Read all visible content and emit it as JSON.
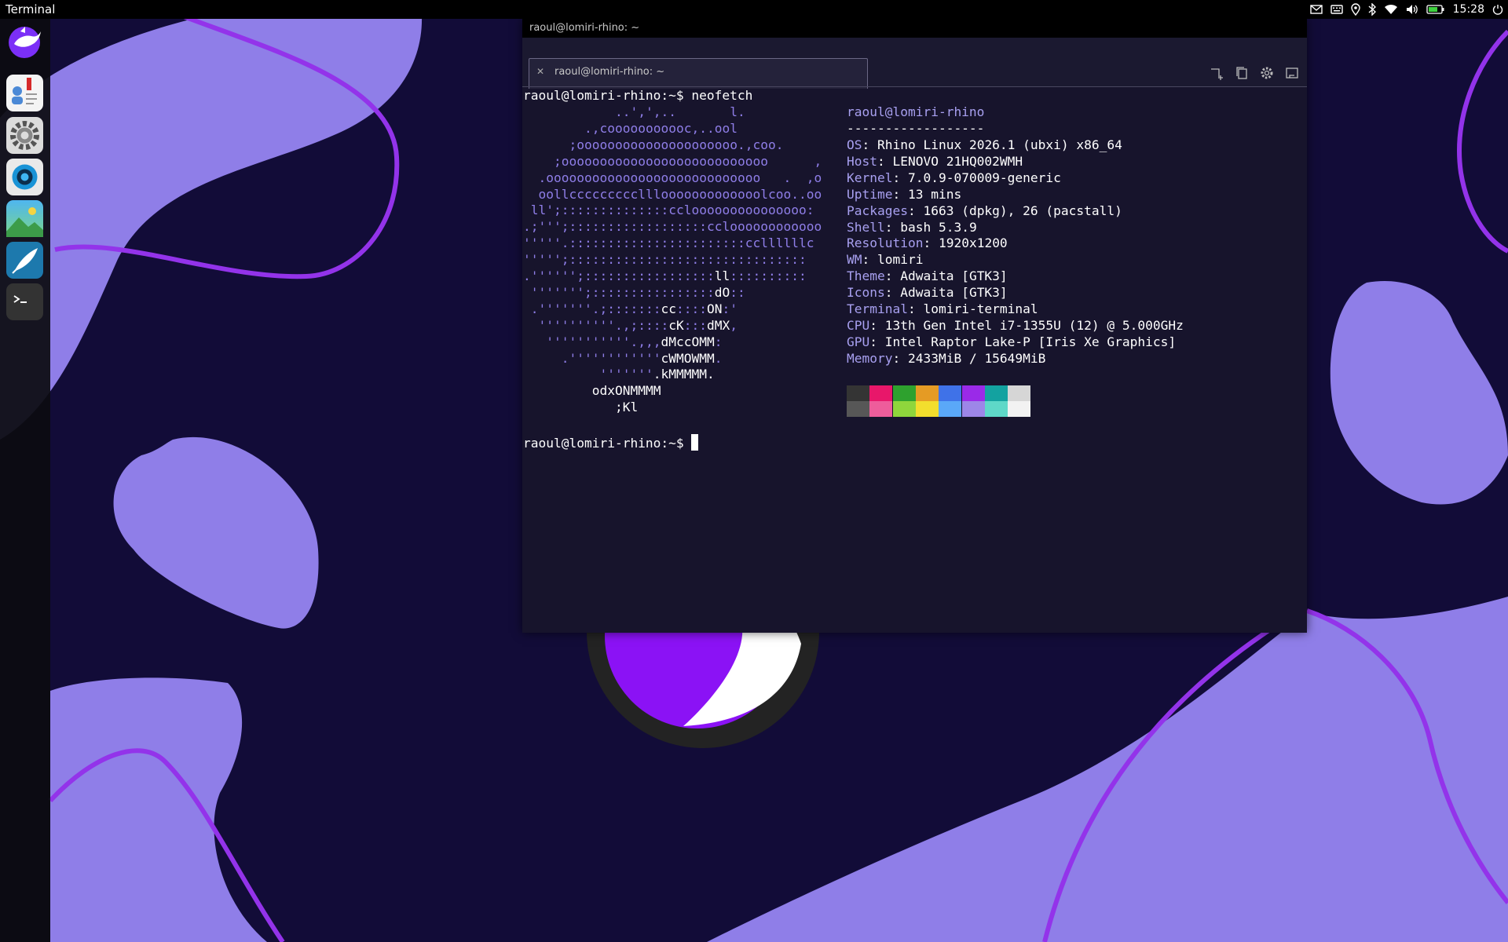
{
  "top_panel": {
    "title": "Terminal",
    "clock": "15:28",
    "indicators": [
      "mail-icon",
      "keyboard-icon",
      "bluetooth-icon",
      "location-icon",
      "wifi-icon",
      "volume-icon",
      "battery-icon",
      "power-icon"
    ]
  },
  "launcher": {
    "items": [
      {
        "name": "rhino-logo",
        "icon": "rhino-logo-icon"
      },
      {
        "name": "contacts-app",
        "icon": "contacts-icon"
      },
      {
        "name": "system-settings",
        "icon": "gear-icon"
      },
      {
        "name": "camera-app",
        "icon": "camera-icon"
      },
      {
        "name": "gallery-app",
        "icon": "gallery-icon"
      },
      {
        "name": "text-editor",
        "icon": "quill-icon"
      },
      {
        "name": "terminal-app",
        "icon": "terminal-icon"
      }
    ]
  },
  "terminal": {
    "window_title": "raoul@lomiri-rhino: ~",
    "tab_label": "raoul@lomiri-rhino: ~",
    "toolbar": [
      "new-tab-icon",
      "copy-icon",
      "settings-icon",
      "keyboard-toggle-icon"
    ],
    "prompt": "raoul@lomiri-rhino:~$ ",
    "command": "neofetch",
    "logo_lines": [
      "            ..',',..       l.",
      "        .,cooooooooooc,..ool",
      "      ;ooooooooooooooooooooo.,coo.",
      "    ;ooooooooooooooooooooooooooo      ,",
      "  .oooooooooooooooooooooooooooo   .  ,o",
      "  oollccccccccclllooooooooooooolcoo..oo",
      " ll';::::::::::::::cclooooooooooooooo:",
      ".;''';::::::::::::::::::ccloooooooooooo",
      "'''''.:::::::::::::::::::::::ccllllllc",
      "''''';:::::::::::::::::::::::::::::::",
      ".'''''';:::::::::::::::::ll::::::::::",
      " ''''''';::::::::::::::::dO::",
      " .'''''''.;:::::::cc::::ON:'",
      "  ''''''''''.,;::::cK:::dMX,",
      "   '''''''''''.,,,dMccOMM:",
      "     .''''''''''''cWMOWMM.",
      "          '''''''.kMMMMM.",
      "         odxONMMMM",
      "            ;Kl"
    ],
    "info_header": "raoul@lomiri-rhino",
    "separator": "------------------",
    "info": [
      {
        "label": "OS",
        "value": "Rhino Linux 2026.1 (ubxi) x86_64"
      },
      {
        "label": "Host",
        "value": "LENOVO 21HQ002WMH"
      },
      {
        "label": "Kernel",
        "value": "7.0.9-070009-generic"
      },
      {
        "label": "Uptime",
        "value": "13 mins"
      },
      {
        "label": "Packages",
        "value": "1663 (dpkg), 26 (pacstall)"
      },
      {
        "label": "Shell",
        "value": "bash 5.3.9"
      },
      {
        "label": "Resolution",
        "value": "1920x1200"
      },
      {
        "label": "WM",
        "value": "lomiri"
      },
      {
        "label": "Theme",
        "value": "Adwaita [GTK3]"
      },
      {
        "label": "Icons",
        "value": "Adwaita [GTK3]"
      },
      {
        "label": "Terminal",
        "value": "lomiri-terminal"
      },
      {
        "label": "CPU",
        "value": "13th Gen Intel i7-1355U (12) @ 5.000GHz"
      },
      {
        "label": "GPU",
        "value": "Intel Raptor Lake-P [Iris Xe Graphics]"
      },
      {
        "label": "Memory",
        "value": "2433MiB / 15649MiB"
      }
    ],
    "palette_top": [
      "#343434",
      "#e8176a",
      "#2ea12e",
      "#e59b24",
      "#3f72e8",
      "#9a2ae8",
      "#13a2a0",
      "#d6d6d6"
    ],
    "palette_bottom": [
      "#575757",
      "#ee5d9b",
      "#8fd63c",
      "#f3de2d",
      "#5aa8f8",
      "#9d86e8",
      "#5ed8c8",
      "#f2f2f2"
    ]
  }
}
